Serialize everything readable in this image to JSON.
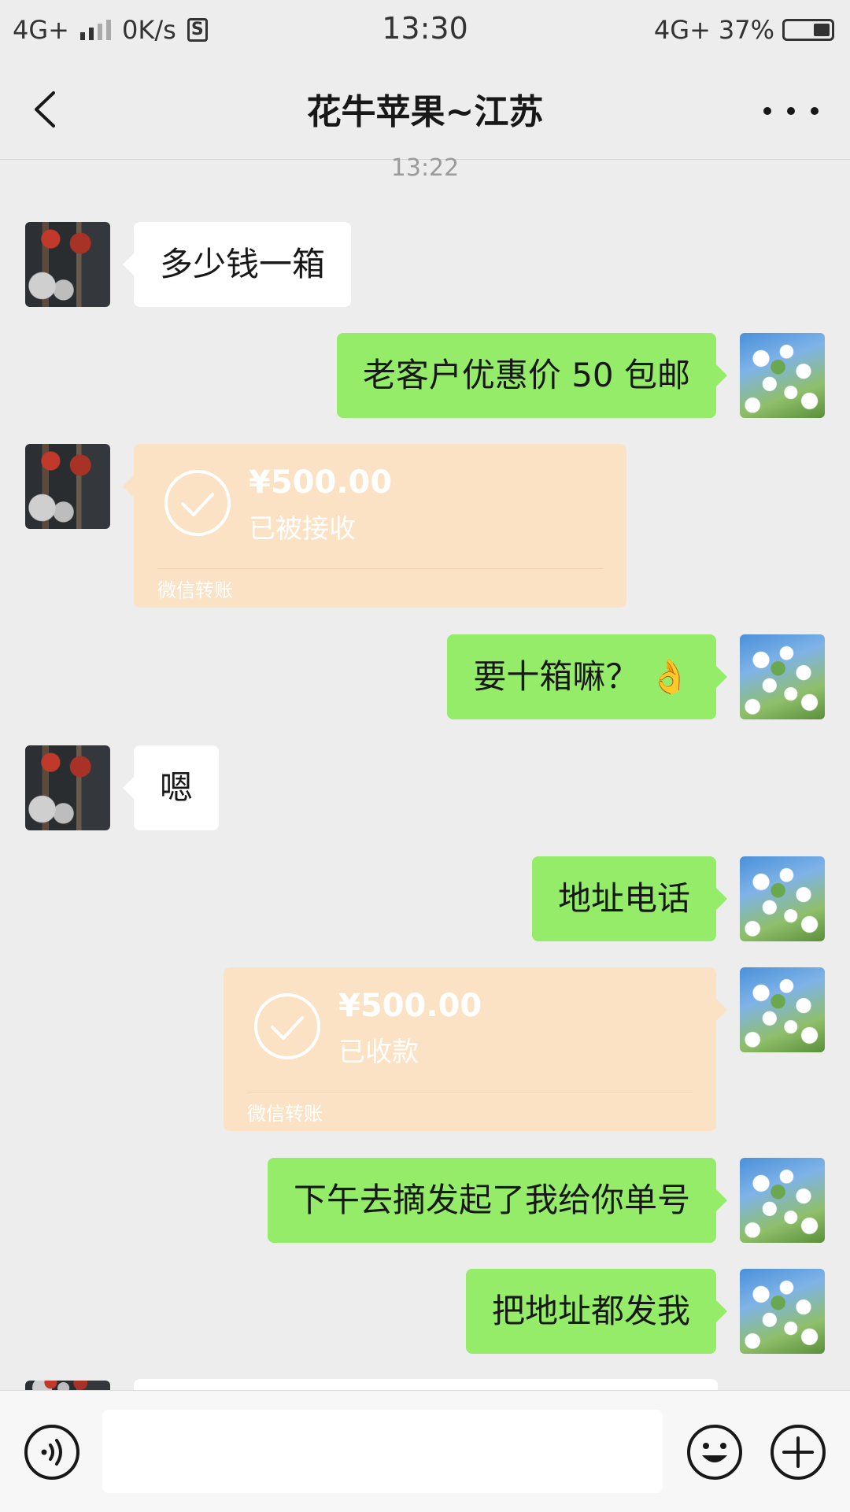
{
  "status_bar": {
    "network": "4G+",
    "speed": "0K/s",
    "s_icon_label": "S",
    "time": "13:30",
    "network_right": "4G+",
    "battery_percent": "37%",
    "battery_level": 0.37
  },
  "header": {
    "back_icon": "chevron-left-icon",
    "title": "花牛苹果~江苏",
    "more_icon": "more-dots-icon"
  },
  "chat": {
    "timestamp": "13:22",
    "messages": [
      {
        "side": "left",
        "type": "text",
        "text": "多少钱一箱"
      },
      {
        "side": "right",
        "type": "text",
        "text": "老客户优惠价 50 包邮"
      },
      {
        "side": "left",
        "type": "transfer",
        "amount": "¥500.00",
        "status": "已被接收",
        "label": "微信转账"
      },
      {
        "side": "right",
        "type": "text",
        "text": "要十箱嘛？",
        "emoji": "👌"
      },
      {
        "side": "left",
        "type": "text",
        "text": "嗯"
      },
      {
        "side": "right",
        "type": "text",
        "text": "地址电话"
      },
      {
        "side": "right",
        "type": "transfer",
        "amount": "¥500.00",
        "status": "已收款",
        "label": "微信转账"
      },
      {
        "side": "right",
        "type": "text",
        "text": "下午去摘发起了我给你单号"
      },
      {
        "side": "right",
        "type": "text",
        "text": "把地址都发我"
      }
    ]
  },
  "input_bar": {
    "voice_icon": "voice-icon",
    "input_value": "",
    "emoji_icon": "emoji-smile-icon",
    "plus_icon": "plus-circle-icon"
  },
  "colors": {
    "background": "#ededed",
    "incoming_bubble": "#ffffff",
    "outgoing_bubble": "#95ec69",
    "transfer_card": "#fce2c4"
  }
}
